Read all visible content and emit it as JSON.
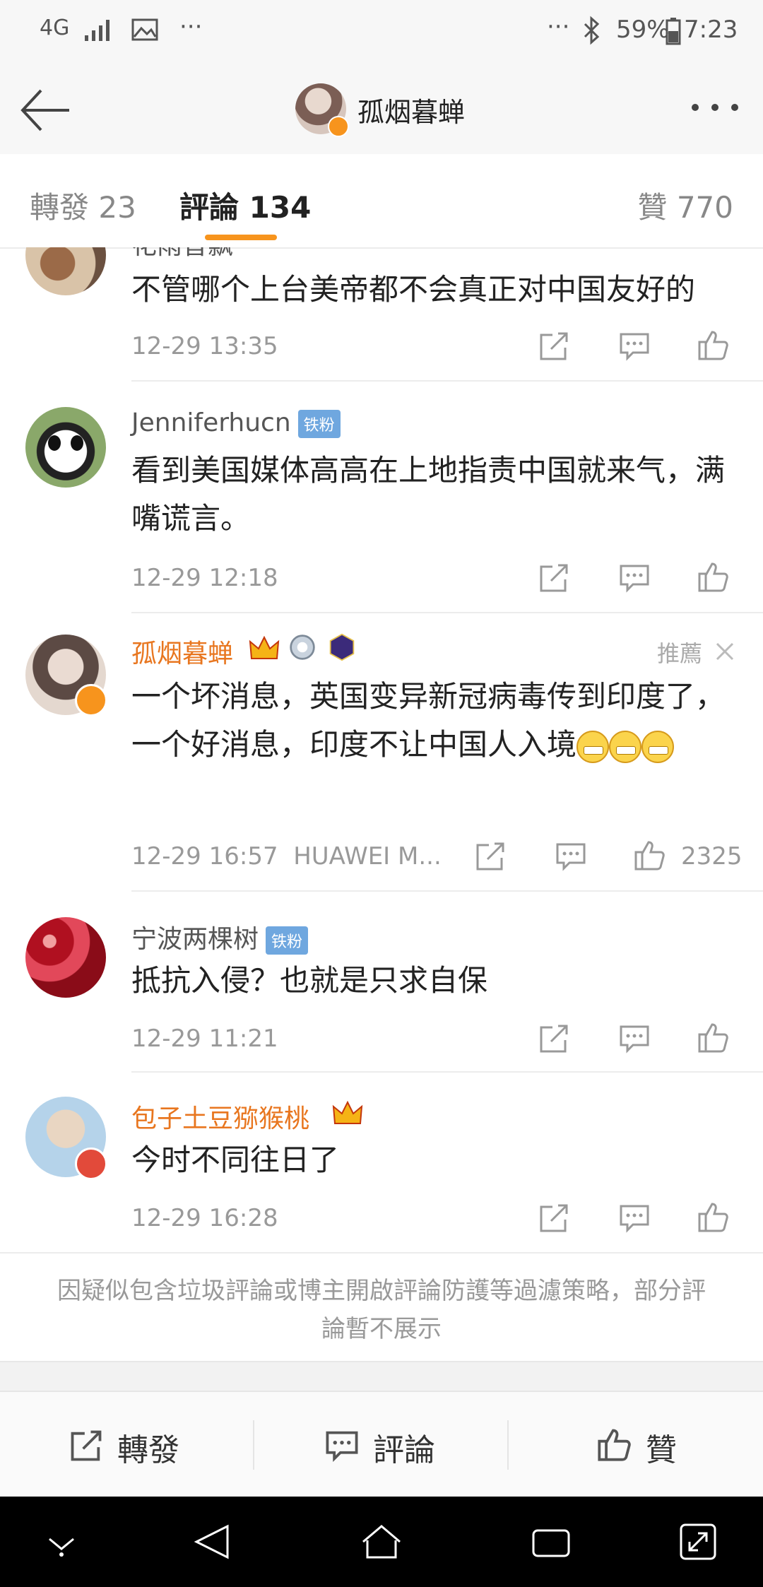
{
  "status_bar": {
    "network": "4G",
    "battery": "59%",
    "time": "7:23",
    "ellipsis": "···"
  },
  "nav": {
    "title": "孤烟暮蝉"
  },
  "tabs": {
    "repost": "轉發 23",
    "comment": "評論 134",
    "like": "贊 770"
  },
  "comments": [
    {
      "name": "花雨音飘",
      "text": "不管哪个上台美帝都不会真正对中国友好的",
      "time": "12-29 13:35"
    },
    {
      "name": "Jenniferhucn",
      "badge": "铁粉",
      "text": "看到美国媒体高高在上地指责中国就来气，满嘴谎言。",
      "time": "12-29 12:18"
    },
    {
      "name": "孤烟暮蝉",
      "recommend": "推薦",
      "text": "一个坏消息，英国变异新冠病毒传到印度了，一个好消息，印度不让中国人入境",
      "time": "12-29 16:57",
      "device": "HUAWEI M...",
      "likes": "2325"
    },
    {
      "name": "宁波两棵树",
      "badge": "铁粉",
      "text": "抵抗入侵？也就是只求自保",
      "time": "12-29 11:21"
    },
    {
      "name": "包子土豆猕猴桃",
      "text": "今时不同往日了",
      "time": "12-29 16:28"
    }
  ],
  "notice": "因疑似包含垃圾評論或博主開啟評論防護等過濾策略，部分評論暫不展示",
  "bottom_bar": {
    "repost": "轉發",
    "comment": "評論",
    "like": "贊"
  },
  "colors": {
    "accent": "#f7941d",
    "vip_name": "#e8761f",
    "fan_badge": "#6fa7df"
  }
}
